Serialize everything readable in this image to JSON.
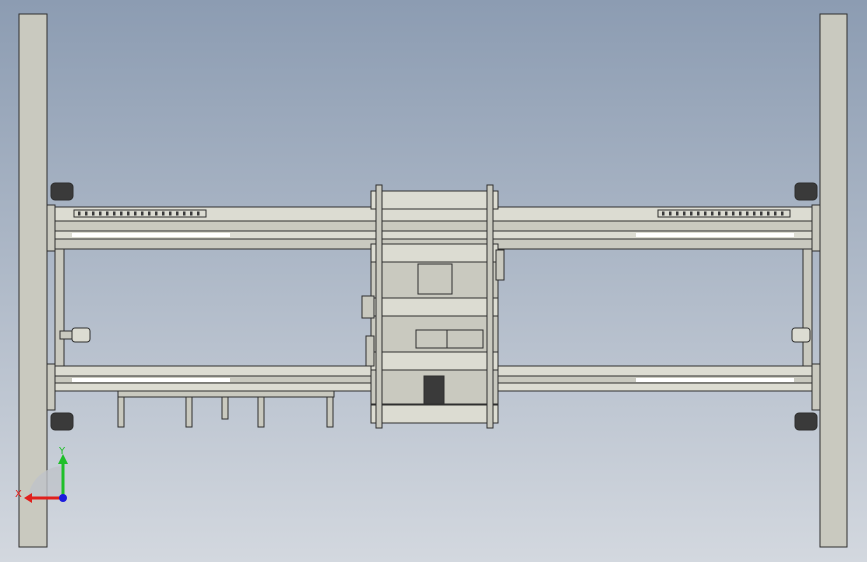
{
  "viewport": {
    "background_top": "#8c9cb2",
    "background_bottom": "#d3d8df"
  },
  "colors": {
    "part_fill": "#c9c9bf",
    "part_fill_light": "#dcdcd2",
    "part_stroke": "#2f2f2f",
    "shadow": "#9a9a92",
    "dark_part": "#3a3a3a",
    "axis_x": "#e0201c",
    "axis_y": "#1fbf2a",
    "axis_z": "#1b1bdd"
  },
  "triad": {
    "x_label": "X",
    "y_label": "Y"
  },
  "icons": [
    "coordinate-triad-icon"
  ]
}
